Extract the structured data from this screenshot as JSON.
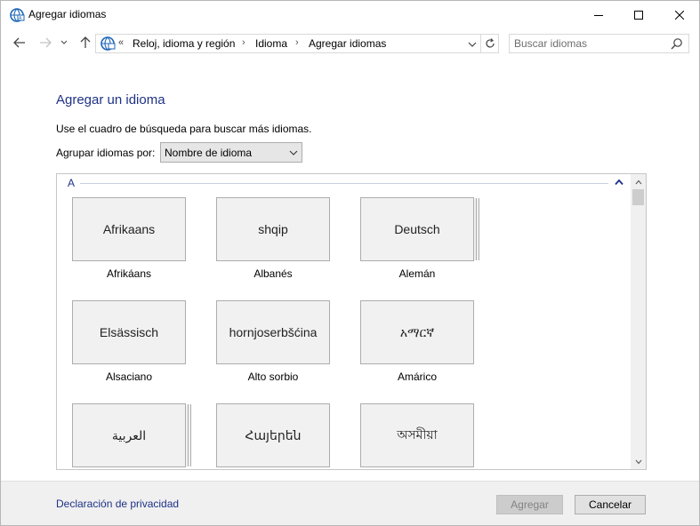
{
  "window": {
    "title": "Agregar idiomas"
  },
  "navigation": {
    "overflow": "«",
    "breadcrumb": [
      "Reloj, idioma y región",
      "Idioma",
      "Agregar idiomas"
    ],
    "search_placeholder": "Buscar idiomas"
  },
  "main": {
    "heading": "Agregar un idioma",
    "description": "Use el cuadro de búsqueda para buscar más idiomas.",
    "group_by_label": "Agrupar idiomas por:",
    "group_by_value": "Nombre de idioma"
  },
  "list": {
    "group_letter": "A",
    "languages": [
      {
        "native": "Afrikaans",
        "name": "Afrikáans"
      },
      {
        "native": "shqip",
        "name": "Albanés"
      },
      {
        "native": "Deutsch",
        "name": "Alemán"
      },
      {
        "native": "Elsässisch",
        "name": "Alsaciano"
      },
      {
        "native": "hornjoserbšćina",
        "name": "Alto sorbio"
      },
      {
        "native": "አማርኛ",
        "name": "Amárico"
      },
      {
        "native": "العربية",
        "name": ""
      },
      {
        "native": "Հայերեն",
        "name": ""
      },
      {
        "native": "অসমীয়া",
        "name": ""
      }
    ]
  },
  "footer": {
    "privacy_link": "Declaración de privacidad",
    "add_button": "Agregar",
    "cancel_button": "Cancelar"
  },
  "colors": {
    "accent": "#1e3287",
    "tile_background": "#f1f1f1",
    "footer_background": "#f0f0f0"
  }
}
